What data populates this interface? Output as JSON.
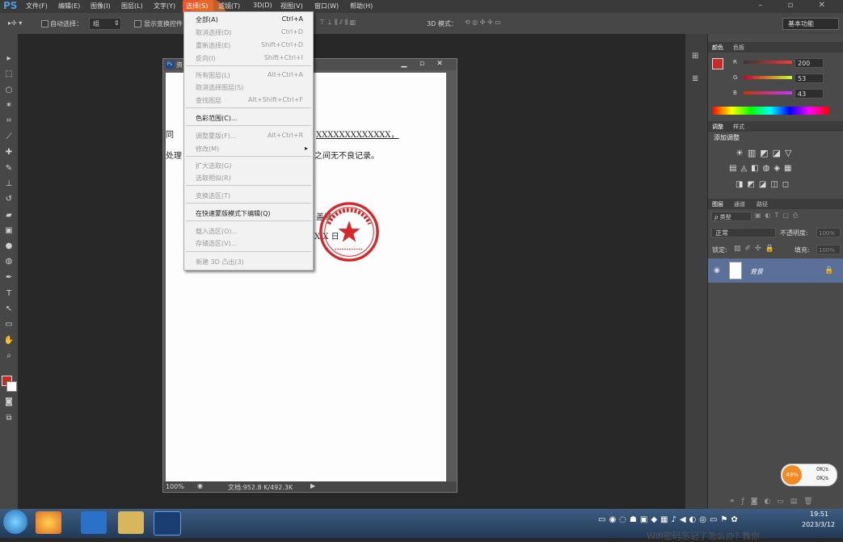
{
  "app": {
    "logo": "PS"
  },
  "menubar": {
    "items": [
      "文件(F)",
      "编辑(E)",
      "图像(I)",
      "图层(L)",
      "文字(Y)",
      "选择(S)",
      "滤镜(T)",
      "3D(D)",
      "视图(V)",
      "窗口(W)",
      "帮助(H)"
    ],
    "active": "选择(S)"
  },
  "options": {
    "auto_select": "自动选择：",
    "group": "组",
    "show_transform": "显示变换控件",
    "mode3d": "3D 模式：",
    "workspace": "基本功能"
  },
  "document": {
    "title": "资",
    "lines": [
      "同",
      "XXXXXXXXXXXXX，",
      "处理",
      "之间无不良记录。",
      "盖章",
      "X X 日"
    ],
    "zoom": "100%",
    "doc_size": "文档:952.8 K/492.3K"
  },
  "select_menu": {
    "items": [
      {
        "label": "全部(A)",
        "shortcut": "Ctrl+A",
        "disabled": false
      },
      {
        "label": "取消选择(D)",
        "shortcut": "Ctrl+D",
        "disabled": true
      },
      {
        "label": "重新选择(E)",
        "shortcut": "Shift+Ctrl+D",
        "disabled": true
      },
      {
        "label": "反向(I)",
        "shortcut": "Shift+Ctrl+I",
        "disabled": true
      },
      {
        "label": "所有图层(L)",
        "shortcut": "Alt+Ctrl+A",
        "disabled": true
      },
      {
        "label": "取消选择图层(S)",
        "shortcut": "",
        "disabled": true
      },
      {
        "label": "查找图层",
        "shortcut": "Alt+Shift+Ctrl+F",
        "disabled": true
      },
      {
        "label": "色彩范围(C)...",
        "shortcut": "",
        "disabled": false
      },
      {
        "label": "调整蒙版(F)...",
        "shortcut": "Alt+Ctrl+R",
        "disabled": true
      },
      {
        "label": "修改(M)",
        "shortcut": "▸",
        "disabled": true
      },
      {
        "label": "扩大选取(G)",
        "shortcut": "",
        "disabled": true
      },
      {
        "label": "选取相似(R)",
        "shortcut": "",
        "disabled": true
      },
      {
        "label": "变换选区(T)",
        "shortcut": "",
        "disabled": true
      },
      {
        "label": "在快速蒙版模式下编辑(Q)",
        "shortcut": "",
        "disabled": false
      },
      {
        "label": "载入选区(O)...",
        "shortcut": "",
        "disabled": true
      },
      {
        "label": "存储选区(V)...",
        "shortcut": "",
        "disabled": true
      },
      {
        "label": "新建 3D 凸出(3)",
        "shortcut": "",
        "disabled": true
      }
    ]
  },
  "color_panel": {
    "tabs": [
      "颜色",
      "色板"
    ],
    "r_label": "R",
    "g_label": "G",
    "b_label": "B",
    "r": "200",
    "g": "53",
    "b": "43",
    "fg_color": "#c72b26"
  },
  "adjust_panel": {
    "tabs": [
      "调整",
      "样式"
    ],
    "title": "添加调整"
  },
  "layers_panel": {
    "tabs": [
      "图层",
      "通道",
      "路径"
    ],
    "kind": "ρ 类型",
    "blend": "正常",
    "opacity_label": "不透明度:",
    "opacity": "100%",
    "lock_label": "锁定:",
    "fill_label": "填充:",
    "fill": "100%",
    "layer_name": "背景"
  },
  "speed": {
    "percent": "49%",
    "up": "0K/s",
    "down": "0K/s"
  },
  "taskbar": {
    "time": "19:51",
    "date": "2023/3/12"
  },
  "overlay": {
    "text": "Wifi密码忘记了怎么办? 教你"
  }
}
